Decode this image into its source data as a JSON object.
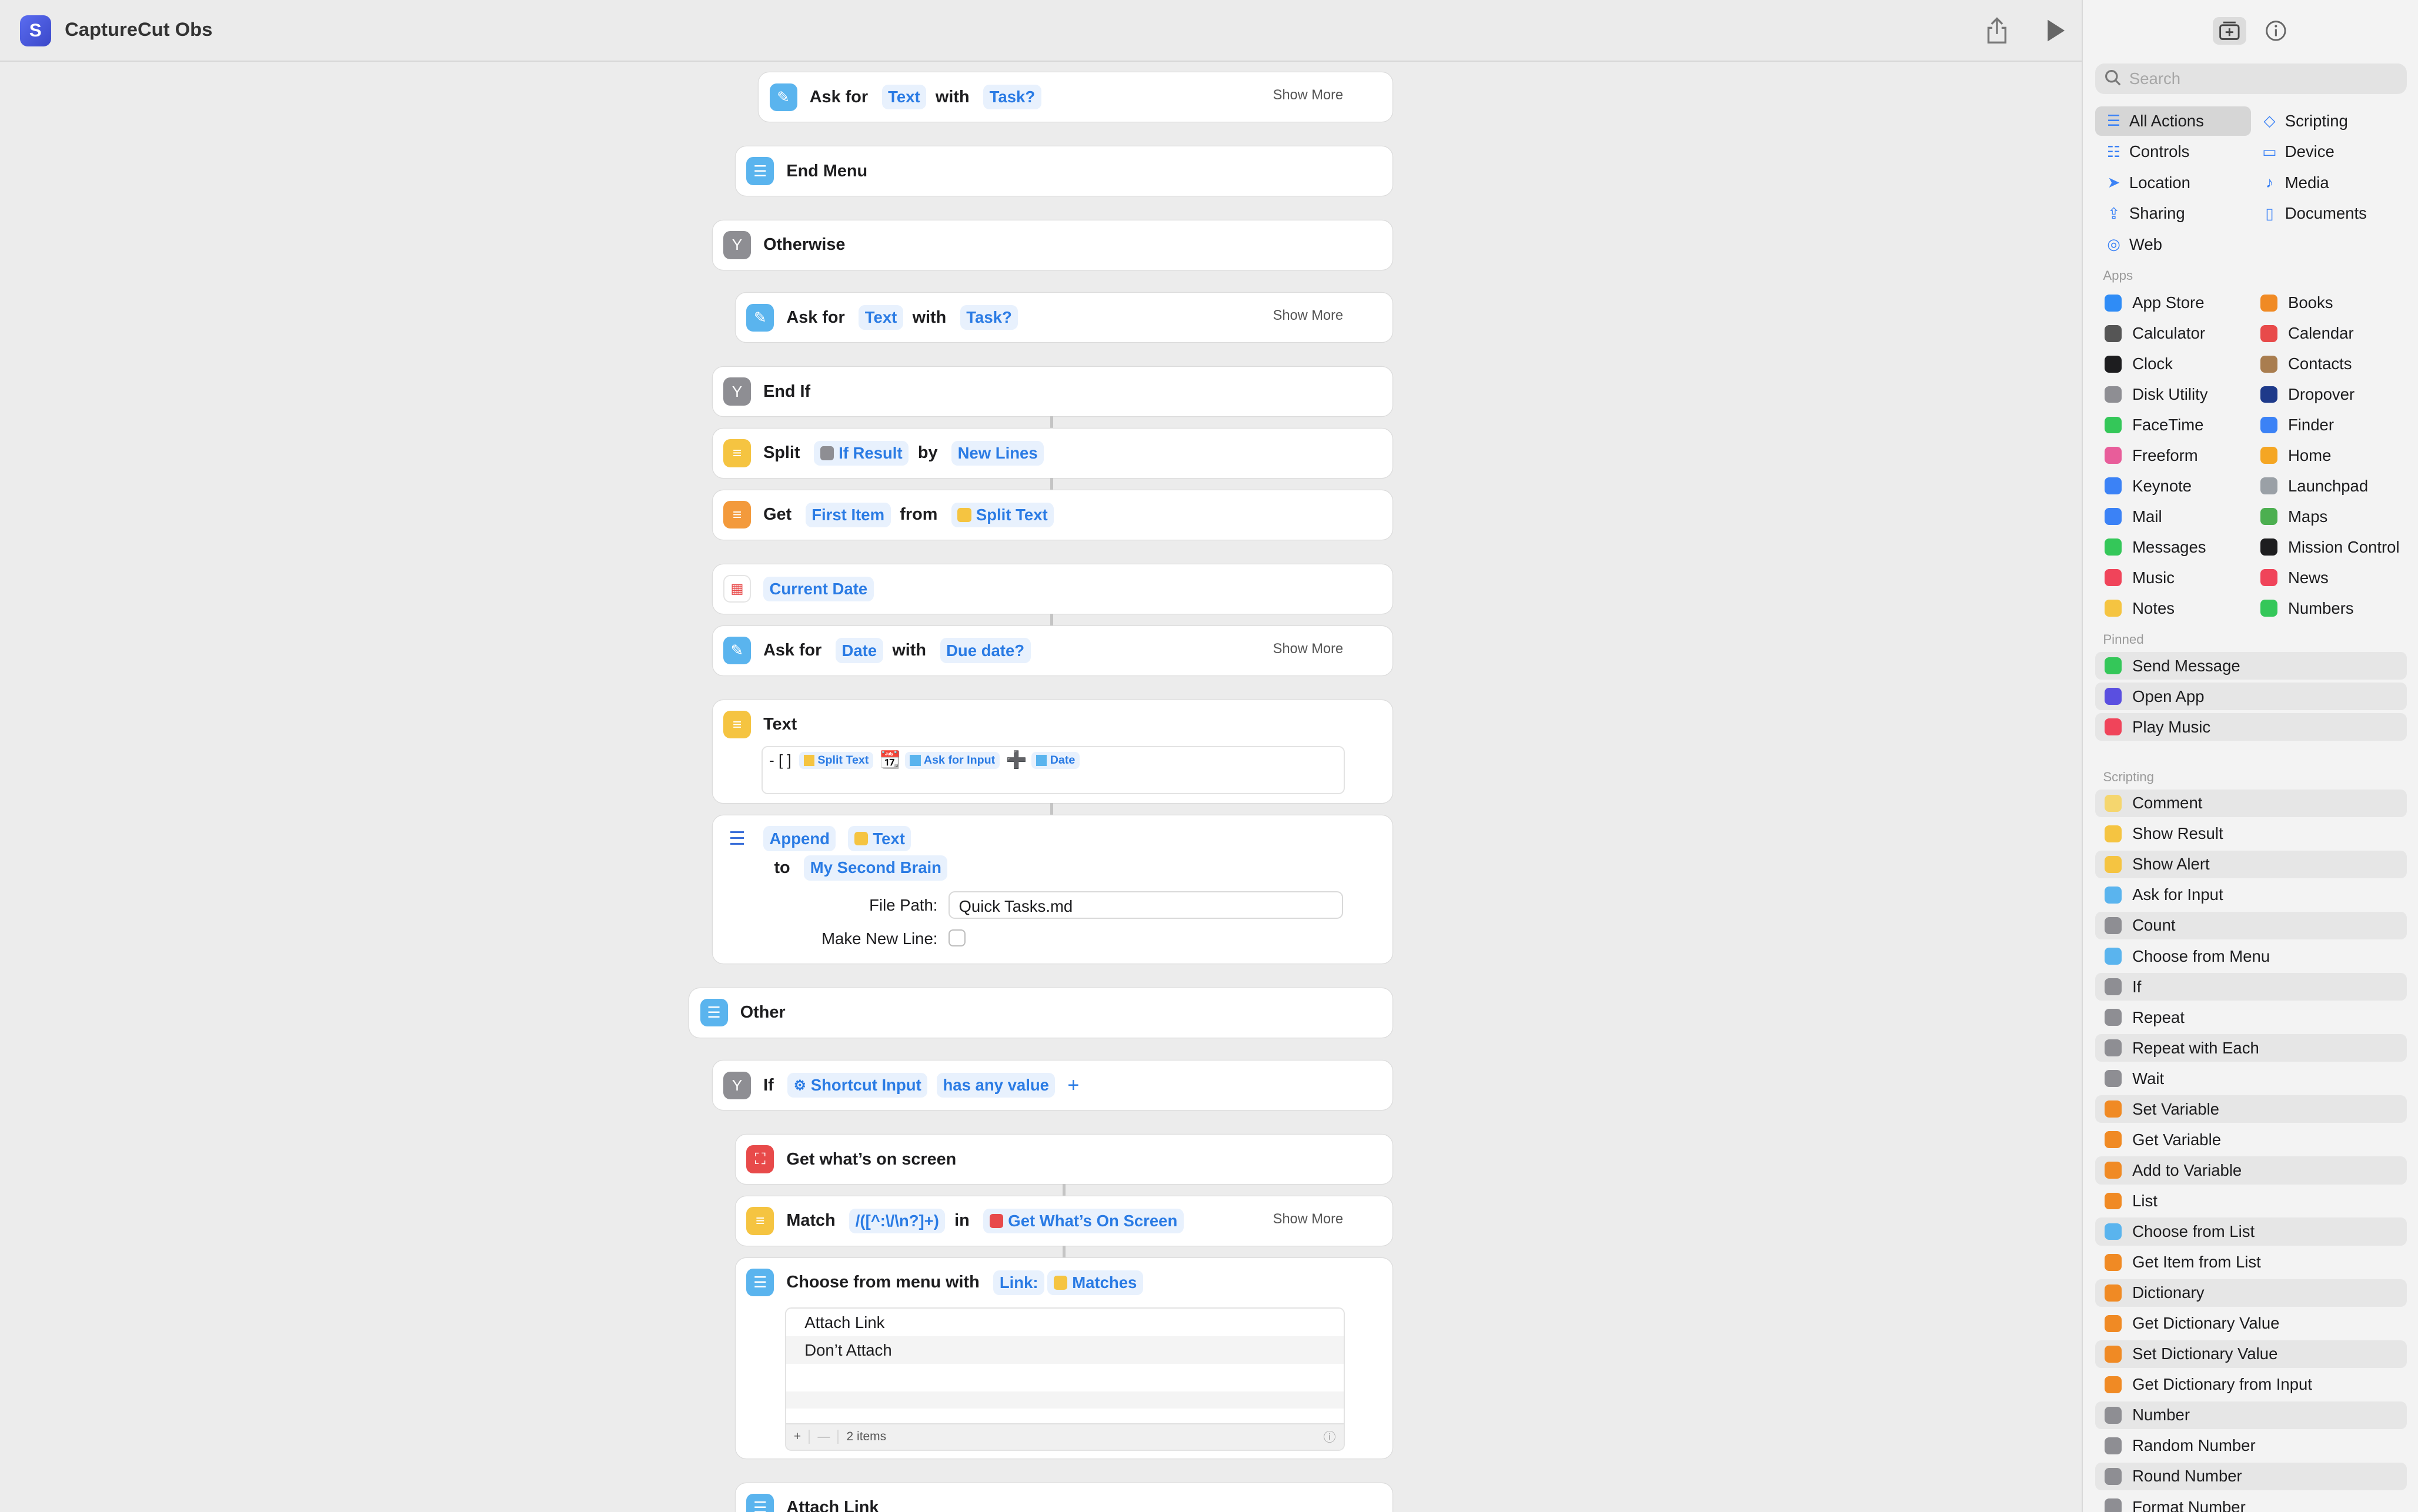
{
  "window": {
    "title": "CaptureCut Obs"
  },
  "editor": {
    "ask_text_1": {
      "kw": "Ask for",
      "type": "Text",
      "with": "with",
      "prompt": "Task?",
      "more": "Show More"
    },
    "end_menu": {
      "label": "End Menu"
    },
    "otherwise": {
      "label": "Otherwise"
    },
    "ask_text_2": {
      "kw": "Ask for",
      "type": "Text",
      "with": "with",
      "prompt": "Task?",
      "more": "Show More"
    },
    "end_if": {
      "label": "End If"
    },
    "split": {
      "kw": "Split",
      "input": "If Result",
      "by": "by",
      "sep": "New Lines"
    },
    "get_item": {
      "kw": "Get",
      "item": "First Item",
      "from": "from",
      "src": "Split Text"
    },
    "current_date": {
      "label": "Current Date"
    },
    "ask_date": {
      "kw": "Ask for",
      "type": "Date",
      "with": "with",
      "prompt": "Due date?",
      "more": "Show More"
    },
    "text_action": {
      "kw": "Text",
      "prefix": "- [ ]",
      "tok1": "Split Text",
      "emoji": "📆",
      "tok2": "Ask for Input",
      "plus": "➕",
      "tok3": "Date"
    },
    "append": {
      "kw": "Append",
      "tok": "Text",
      "to": "to",
      "dest": "My Second Brain",
      "file_path_label": "File Path:",
      "file_path_value": "Quick Tasks.md",
      "new_line_label": "Make New Line:"
    },
    "other": {
      "label": "Other"
    },
    "if_action": {
      "kw": "If",
      "input": "Shortcut Input",
      "cond": "has any value"
    },
    "get_screen": {
      "label": "Get what’s on screen"
    },
    "match": {
      "kw": "Match",
      "pattern": "/([^:\\/\\n?]+)",
      "in": "in",
      "src": "Get What’s On Screen",
      "more": "Show More"
    },
    "choose_menu": {
      "kw": "Choose from menu with",
      "prompt_label": "Link:",
      "prompt_tok": "Matches",
      "items": [
        "Attach Link",
        "Don’t Attach"
      ],
      "count": "2 items"
    },
    "attach_link": {
      "label": "Attach Link"
    }
  },
  "sidebar": {
    "search_placeholder": "Search",
    "categories": [
      {
        "label": "All Actions",
        "icon": "list-icon"
      },
      {
        "label": "Scripting",
        "icon": "scripting-icon"
      },
      {
        "label": "Controls",
        "icon": "controls-icon"
      },
      {
        "label": "Device",
        "icon": "device-icon"
      },
      {
        "label": "Location",
        "icon": "location-icon"
      },
      {
        "label": "Media",
        "icon": "music-note-icon"
      },
      {
        "label": "Sharing",
        "icon": "share-icon"
      },
      {
        "label": "Documents",
        "icon": "document-icon"
      },
      {
        "label": "Web",
        "icon": "compass-icon"
      }
    ],
    "apps_header": "Apps",
    "apps": [
      {
        "label": "App Store",
        "color": "#2f8cf6"
      },
      {
        "label": "Books",
        "color": "#f08a24"
      },
      {
        "label": "Calculator",
        "color": "#555555"
      },
      {
        "label": "Calendar",
        "color": "#e84a4a"
      },
      {
        "label": "Clock",
        "color": "#1d1d1f"
      },
      {
        "label": "Contacts",
        "color": "#a97d4f"
      },
      {
        "label": "Disk Utility",
        "color": "#8e8e93"
      },
      {
        "label": "Dropover",
        "color": "#1e3a8a"
      },
      {
        "label": "FaceTime",
        "color": "#34c759"
      },
      {
        "label": "Finder",
        "color": "#3b82f6"
      },
      {
        "label": "Freeform",
        "color": "#e85d9a"
      },
      {
        "label": "Home",
        "color": "#f5a623"
      },
      {
        "label": "Keynote",
        "color": "#3b82f6"
      },
      {
        "label": "Launchpad",
        "color": "#9aa0a6"
      },
      {
        "label": "Mail",
        "color": "#3b82f6"
      },
      {
        "label": "Maps",
        "color": "#4caf50"
      },
      {
        "label": "Messages",
        "color": "#34c759"
      },
      {
        "label": "Mission Control",
        "color": "#1d1d1f"
      },
      {
        "label": "Music",
        "color": "#f0445a"
      },
      {
        "label": "News",
        "color": "#f0445a"
      },
      {
        "label": "Notes",
        "color": "#f5c441"
      },
      {
        "label": "Numbers",
        "color": "#34c759"
      }
    ],
    "pinned_header": "Pinned",
    "pinned": [
      {
        "label": "Send Message",
        "color": "#34c759"
      },
      {
        "label": "Open App",
        "color": "#5a4fe0"
      },
      {
        "label": "Play Music",
        "color": "#f0445a"
      }
    ],
    "scripting_header": "Scripting",
    "scripting": [
      {
        "label": "Comment",
        "color": "#f5d66e"
      },
      {
        "label": "Show Result",
        "color": "#f5c441"
      },
      {
        "label": "Show Alert",
        "color": "#f5c441"
      },
      {
        "label": "Ask for Input",
        "color": "#5ab4ee"
      },
      {
        "label": "Count",
        "color": "#8e8e93"
      },
      {
        "label": "Choose from Menu",
        "color": "#5ab4ee"
      },
      {
        "label": "If",
        "color": "#8e8e93"
      },
      {
        "label": "Repeat",
        "color": "#8e8e93"
      },
      {
        "label": "Repeat with Each",
        "color": "#8e8e93"
      },
      {
        "label": "Wait",
        "color": "#8e8e93"
      },
      {
        "label": "Set Variable",
        "color": "#f08a24"
      },
      {
        "label": "Get Variable",
        "color": "#f08a24"
      },
      {
        "label": "Add to Variable",
        "color": "#f08a24"
      },
      {
        "label": "List",
        "color": "#f08a24"
      },
      {
        "label": "Choose from List",
        "color": "#5ab4ee"
      },
      {
        "label": "Get Item from List",
        "color": "#f08a24"
      },
      {
        "label": "Dictionary",
        "color": "#f08a24"
      },
      {
        "label": "Get Dictionary Value",
        "color": "#f08a24"
      },
      {
        "label": "Set Dictionary Value",
        "color": "#f08a24"
      },
      {
        "label": "Get Dictionary from Input",
        "color": "#f08a24"
      },
      {
        "label": "Number",
        "color": "#8e8e93"
      },
      {
        "label": "Random Number",
        "color": "#8e8e93"
      },
      {
        "label": "Round Number",
        "color": "#8e8e93"
      },
      {
        "label": "Format Number",
        "color": "#8e8e93"
      }
    ]
  }
}
